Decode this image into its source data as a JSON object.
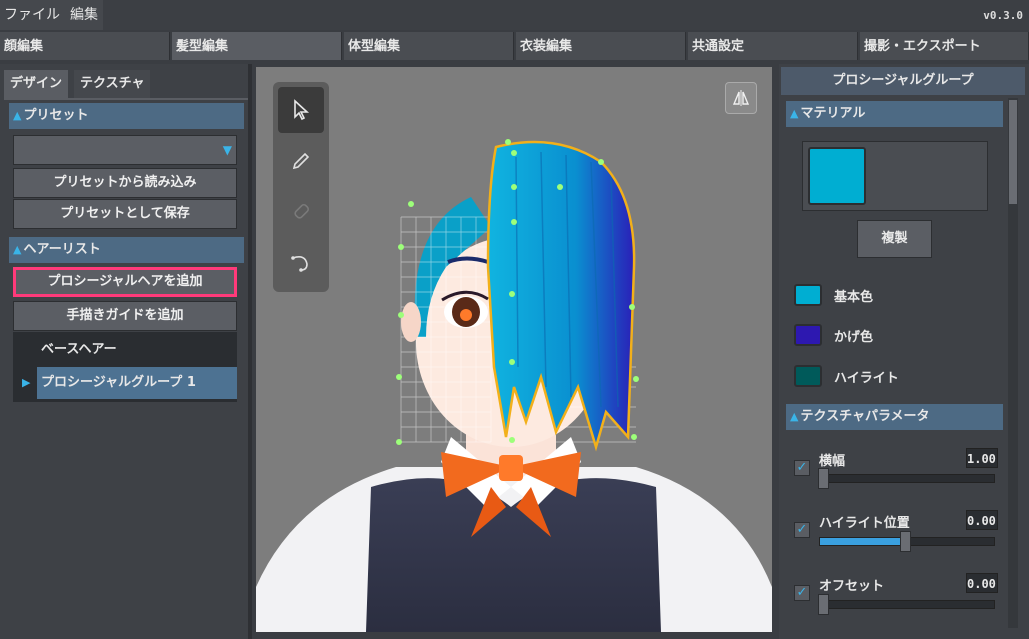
{
  "menubar": {
    "items": [
      "ファイル",
      "編集"
    ],
    "version": "v0.3.0"
  },
  "tabs": [
    "顔編集",
    "髪型編集",
    "体型編集",
    "衣装編集",
    "共通設定",
    "撮影・エクスポート"
  ],
  "left": {
    "subtabs": [
      "デザイン",
      "テクスチャ"
    ],
    "preset": {
      "header": "プリセット",
      "dropdown_value": "",
      "load_label": "プリセットから読み込み",
      "save_label": "プリセットとして保存"
    },
    "hairlist": {
      "header": "ヘアーリスト",
      "add_procedural_label": "プロシージャルヘアを追加",
      "add_guide_label": "手描きガイドを追加",
      "items": [
        "ベースヘアー",
        "プロシージャルグループ 1"
      ]
    }
  },
  "right": {
    "title": "プロシージャルグループ",
    "material": {
      "header": "マテリアル",
      "duplicate_label": "複製",
      "colors": [
        {
          "label": "基本色",
          "color": "#00aed2"
        },
        {
          "label": "かげ色",
          "color": "#2d18b0"
        },
        {
          "label": "ハイライト",
          "color": "#005a5a"
        }
      ]
    },
    "texture_params": {
      "header": "テクスチャパラメータ",
      "params": [
        {
          "label": "横幅",
          "value": "1.00",
          "checked": true,
          "slider": 0.0
        },
        {
          "label": "ハイライト位置",
          "value": "0.00",
          "checked": true,
          "slider": 0.5
        },
        {
          "label": "オフセット",
          "value": "0.00",
          "checked": true,
          "slider": 0.0
        }
      ]
    }
  },
  "viewport": {
    "tools": [
      "select-tool",
      "pen-tool",
      "eraser-tool",
      "curve-tool"
    ]
  }
}
